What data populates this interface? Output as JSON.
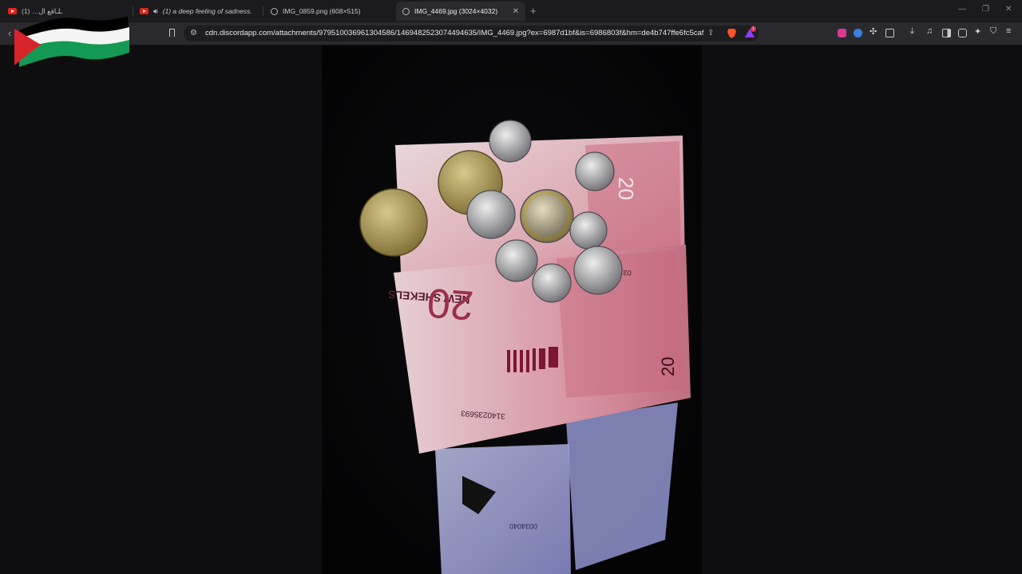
{
  "browser": {
    "tabs": [
      {
        "label": "(1) …ـلـاقع ال",
        "icon": "youtube-icon",
        "active": false
      },
      {
        "label": "(1) a deep feeling of sadness.",
        "icon": "youtube-icon",
        "audio": true,
        "active": false
      },
      {
        "label": "IMG_0859.png (608×515)",
        "icon": "globe-icon",
        "active": false
      },
      {
        "label": "IMG_4469.jpg (3024×4032)",
        "icon": "globe-icon",
        "active": true
      }
    ],
    "new_tab_label": "+",
    "url": "cdn.discordapp.com/attachments/979510036961304586/1469482523074494635/IMG_4469.jpg?ex=6987d1bf&is=6986803f&hm=de4b747ffe6fc5caf...",
    "rewards_badge": "1"
  },
  "photo": {
    "banknote_denomination": "20",
    "currency_text": "NEW SHEKELS",
    "serial_number": "3140235693",
    "serial_fragment": "031",
    "blue_note_number": "0034040"
  },
  "colors": {
    "tab_strip": "#1b1b1e",
    "toolbar": "#2a2a2e",
    "page_bg": "#0e0e10",
    "flag_red": "#d8232a",
    "flag_green": "#149954"
  }
}
